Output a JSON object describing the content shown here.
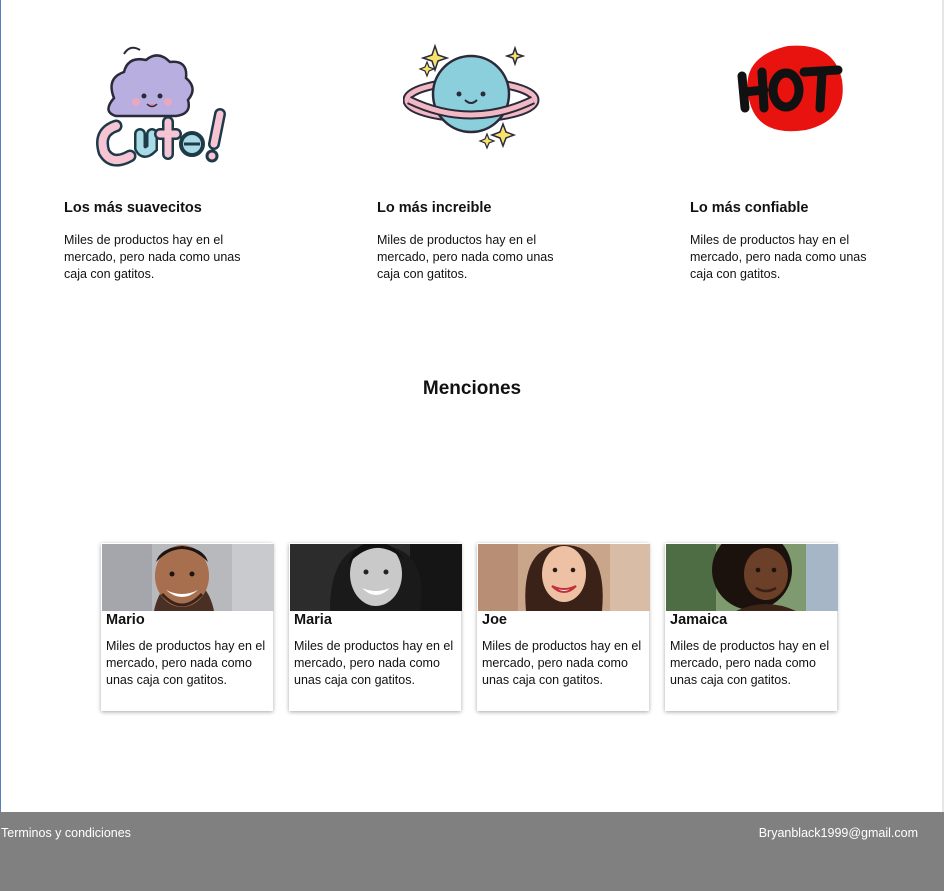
{
  "features": [
    {
      "icon": "cute-sticker-icon",
      "title": "Los más suavecitos",
      "text": "Miles de productos hay en el mercado, pero nada como unas caja con gatitos."
    },
    {
      "icon": "planet-sticker-icon",
      "title": "Lo más increible",
      "text": "Miles de productos hay en el mercado, pero nada como unas caja con gatitos."
    },
    {
      "icon": "hot-sticker-icon",
      "title": "Lo más confiable",
      "text": "Miles de productos hay en el mercado, pero nada como unas caja con gatitos."
    }
  ],
  "mentions": {
    "title": "Menciones",
    "cards": [
      {
        "name": "Mario",
        "text": "Miles de productos hay en el mercado, pero nada como unas caja con gatitos."
      },
      {
        "name": "Maria",
        "text": "Miles de productos hay en el mercado, pero nada como unas caja con gatitos."
      },
      {
        "name": "Joe",
        "text": "Miles de productos hay en el mercado, pero nada como unas caja con gatitos."
      },
      {
        "name": "Jamaica",
        "text": "Miles de productos hay en el mercado, pero nada como unas caja con gatitos."
      }
    ]
  },
  "footer": {
    "terms_label": "Terminos y condiciones",
    "email": "Bryanblack1999@gmail.com"
  },
  "colors": {
    "footer_bg": "#808080",
    "hot_red": "#e8120f",
    "planet_blue": "#8ccfdc",
    "ring_pink": "#f2b8c4",
    "cute_purple": "#b9aee0"
  }
}
